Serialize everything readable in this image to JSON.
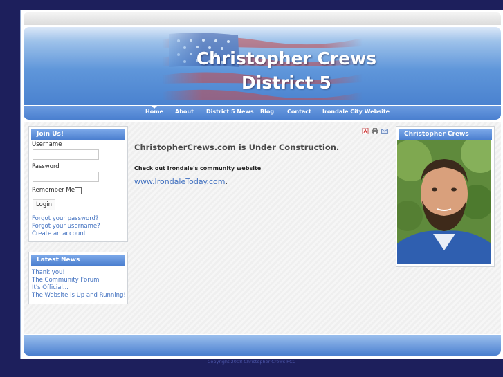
{
  "header": {
    "title_line1": "Christopher Crews",
    "title_line2": "District 5"
  },
  "nav": {
    "items": [
      "Home",
      "About",
      "District 5 News",
      "Blog",
      "Contact",
      "Irondale City Website"
    ],
    "active": "Home"
  },
  "login": {
    "title": "Join Us!",
    "username_label": "Username",
    "password_label": "Password",
    "remember_label": "Remember Me",
    "login_button": "Login",
    "links": [
      "Forgot your password?",
      "Forgot your username?",
      "Create an account"
    ]
  },
  "latest_news": {
    "title": "Latest News",
    "items": [
      "Thank you!",
      "The Community Forum",
      "It's Official...",
      "The Website is Up and Running!"
    ]
  },
  "main": {
    "heading": "ChristopherCrews.com is Under Construction.",
    "subheading": "Check out Irondale's community website",
    "link_text": "www.IrondaleToday.com",
    "link_suffix": "."
  },
  "toolbar": {
    "icons": [
      "pdf-icon",
      "print-icon",
      "email-icon"
    ]
  },
  "profile": {
    "title": "Christopher Crews"
  },
  "footer": {
    "copyright": "Copyright 2008 Christopher Crews PCC"
  },
  "colors": {
    "accent": "#4a7fcf",
    "link": "#3f6fbf",
    "background": "#1d1f5c"
  }
}
